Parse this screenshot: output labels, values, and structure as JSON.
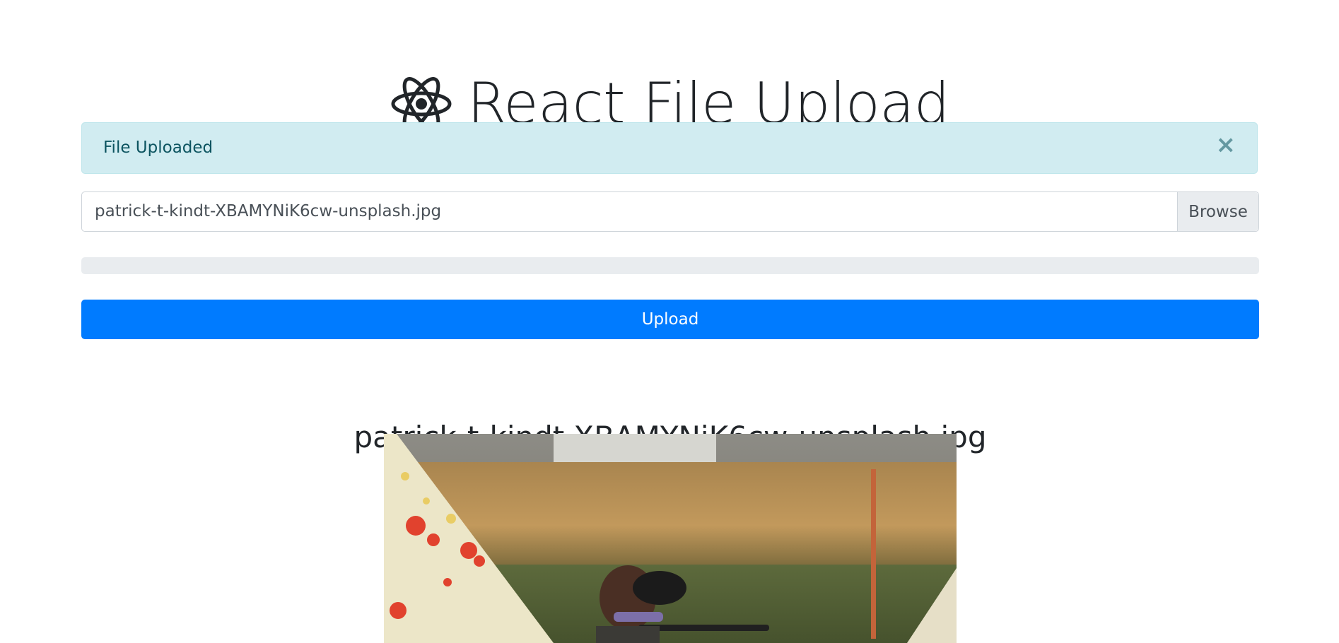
{
  "header": {
    "title": "React File Upload",
    "logo_icon": "react-atom-icon"
  },
  "alert": {
    "message": "File Uploaded",
    "close_label": "×"
  },
  "file_input": {
    "filename": "patrick-t-kindt-XBAMYNiK6cw-unsplash.jpg",
    "browse_label": "Browse"
  },
  "progress": {
    "percent": 0
  },
  "upload_button": {
    "label": "Upload"
  },
  "preview": {
    "filename": "patrick-t-kindt-XBAMYNiK6cw-unsplash.jpg"
  },
  "colors": {
    "primary": "#007bff",
    "alert_bg": "#d1ecf1",
    "alert_text": "#0c5460",
    "progress_track": "#e9ecef"
  }
}
